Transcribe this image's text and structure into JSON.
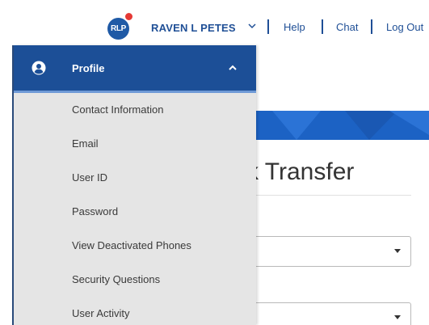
{
  "user_bar": {
    "avatar_initials": "RLP",
    "user_name": "RAVEN L PETES",
    "links": [
      "Help",
      "Chat",
      "Log Out"
    ]
  },
  "menu": {
    "title": "Profile",
    "items": [
      {
        "label": "Contact Information"
      },
      {
        "label": "Email"
      },
      {
        "label": "User ID"
      },
      {
        "label": "Password"
      },
      {
        "label": "View Deactivated Phones"
      },
      {
        "label": "Security Questions"
      },
      {
        "label": "User Activity"
      }
    ]
  },
  "page": {
    "heading_visible": "k Transfer"
  },
  "colors": {
    "brand_blue": "#1c4f97",
    "banner_blue": "#1c62c4",
    "menu_background": "#e5e5e5",
    "notification_red": "#e53935"
  },
  "icons": {
    "profile": "user-circle-icon",
    "menu_toggle": "chevron-up-icon",
    "user_toggle": "chevron-down-icon"
  }
}
